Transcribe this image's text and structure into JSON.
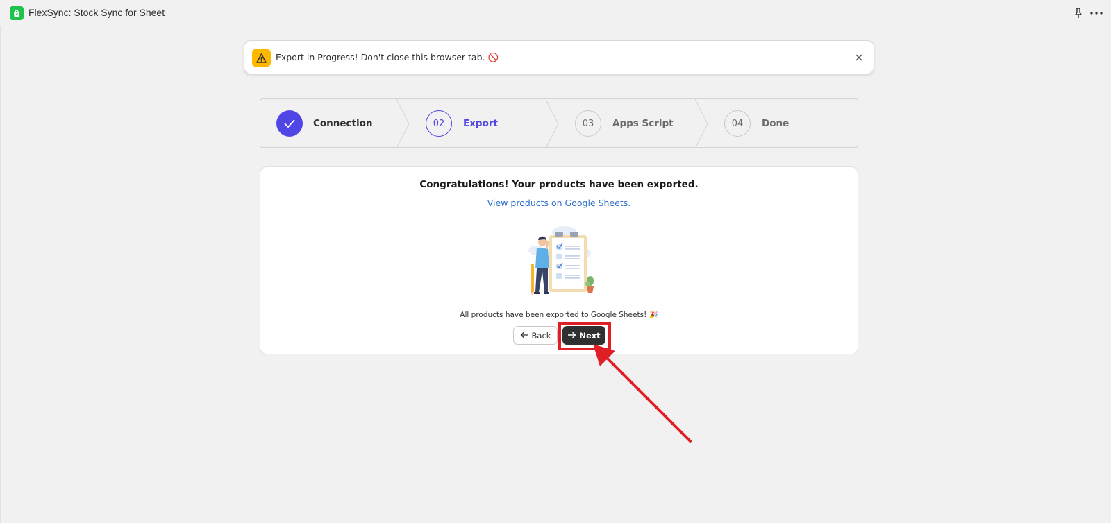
{
  "app": {
    "title": "FlexSync: Stock Sync for Sheet",
    "icon": "shopping-bag-icon"
  },
  "topbar_actions": {
    "pin_icon": "pin-icon",
    "more_icon": "more-icon"
  },
  "banner": {
    "text": "Export in Progress! Don't close this browser tab. 🚫",
    "icon": "warning-icon",
    "close_icon": "close-icon",
    "accent_color": "#ffb800"
  },
  "stepper": {
    "steps": [
      {
        "number": "",
        "label": "Connection",
        "state": "completed"
      },
      {
        "number": "02",
        "label": "Export",
        "state": "active"
      },
      {
        "number": "03",
        "label": "Apps Script",
        "state": "pending"
      },
      {
        "number": "04",
        "label": "Done",
        "state": "pending"
      }
    ],
    "active_color": "#4f46e5"
  },
  "card": {
    "title": "Congratulations! Your products have been exported.",
    "link": "View products on Google Sheets.",
    "note": "All products have been exported to Google Sheets! 🎉",
    "back_label": "Back",
    "next_label": "Next"
  },
  "annotation": {
    "highlight_color": "#e01e25"
  }
}
